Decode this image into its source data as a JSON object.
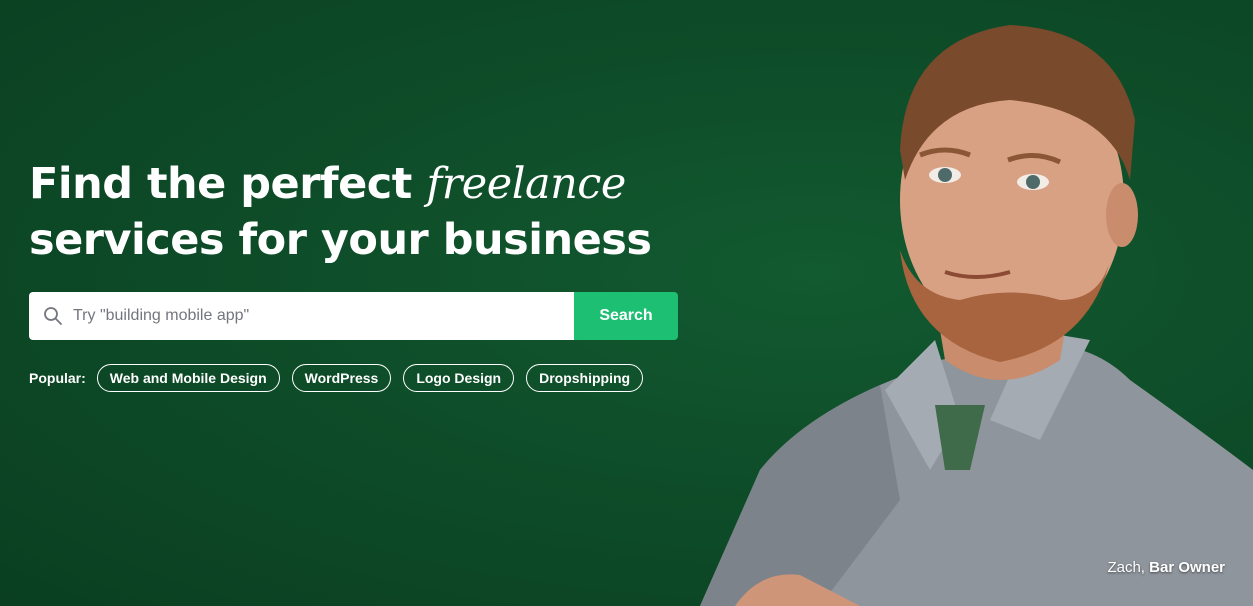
{
  "hero": {
    "headline_part1": "Find the perfect",
    "headline_accent": "freelance",
    "headline_part2": "services for your business"
  },
  "search": {
    "icon": "search-icon",
    "placeholder": "Try \"building mobile app\"",
    "value": "",
    "button_label": "Search"
  },
  "popular": {
    "label": "Popular:",
    "tags": [
      "Web and Mobile Design",
      "WordPress",
      "Logo Design",
      "Dropshipping"
    ]
  },
  "caption": {
    "name": "Zach,",
    "role": "Bar Owner"
  },
  "colors": {
    "background": "#0d4826",
    "accent": "#1dbf73",
    "text": "#ffffff"
  }
}
